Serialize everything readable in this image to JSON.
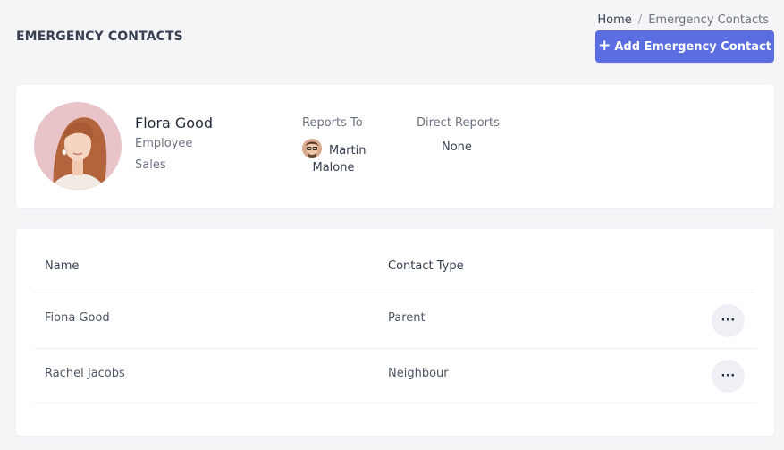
{
  "page": {
    "title": "EMERGENCY CONTACTS",
    "breadcrumb": {
      "home": "Home",
      "separator": "/",
      "current": "Emergency Contacts"
    },
    "add_button": {
      "icon": "plus-icon",
      "label": "Add Emergency Contact"
    }
  },
  "profile": {
    "name": "Flora Good",
    "role": "Employee",
    "department": "Sales",
    "reports_to": {
      "label": "Reports To",
      "first": "Martin",
      "last": "Malone"
    },
    "direct_reports": {
      "label": "Direct Reports",
      "value": "None"
    }
  },
  "contacts": {
    "headers": {
      "name": "Name",
      "type": "Contact Type"
    },
    "rows": [
      {
        "name": "Fiona Good",
        "type": "Parent",
        "action": "···"
      },
      {
        "name": "Rachel Jacobs",
        "type": "Neighbour",
        "action": "···"
      }
    ]
  },
  "colors": {
    "accent": "#5b6ee1",
    "background": "#f5f5f8",
    "card": "#ffffff"
  }
}
